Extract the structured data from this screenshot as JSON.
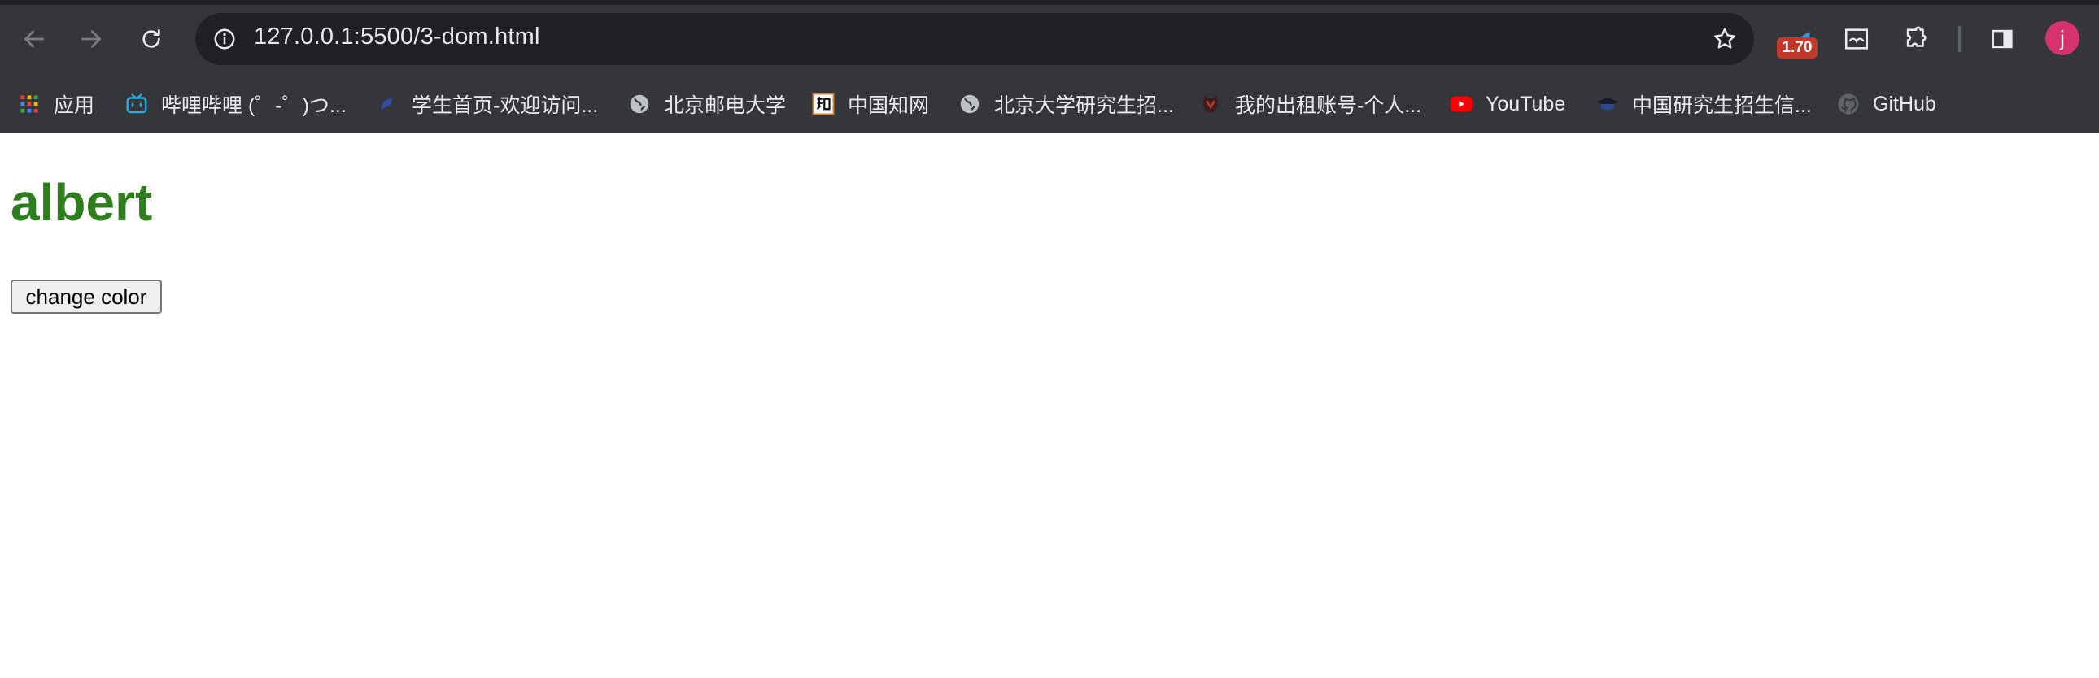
{
  "browser": {
    "url": "127.0.0.1:5500/3-dom.html",
    "extension_badge": "1.70",
    "profile_initial": "j",
    "colors": {
      "frame": "#35363a",
      "omnibox": "#202124",
      "text": "#e8eaed",
      "badge": "#c0392b",
      "avatar": "#d6336c"
    }
  },
  "bookmarks": [
    {
      "label": "应用",
      "icon": "apps-grid-icon"
    },
    {
      "label": "哔哩哔哩 (゜-゜)つ...",
      "icon": "bilibili-icon"
    },
    {
      "label": "学生首页-欢迎访问...",
      "icon": "student-portal-icon"
    },
    {
      "label": "北京邮电大学",
      "icon": "globe-icon"
    },
    {
      "label": "中国知网",
      "icon": "cnki-icon"
    },
    {
      "label": "北京大学研究生招...",
      "icon": "globe-icon"
    },
    {
      "label": "我的出租账号-个人...",
      "icon": "rental-site-icon"
    },
    {
      "label": "YouTube",
      "icon": "youtube-icon"
    },
    {
      "label": "中国研究生招生信...",
      "icon": "graduation-cap-icon"
    },
    {
      "label": "GitHub",
      "icon": "github-icon"
    }
  ],
  "page": {
    "heading": "albert",
    "heading_color": "#2e7d1e",
    "button_label": "change color"
  }
}
